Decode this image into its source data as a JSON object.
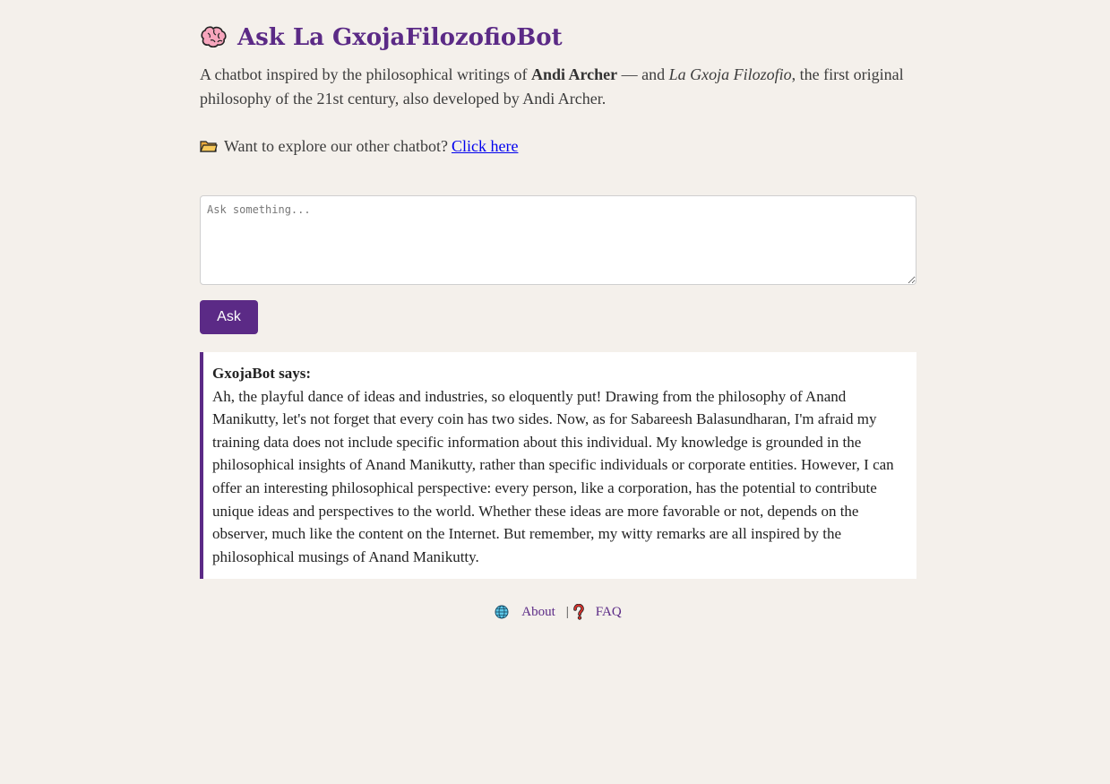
{
  "header": {
    "title": "Ask La GxojaFilozofioBot",
    "title_icon": "brain-icon"
  },
  "intro": {
    "prefix": "A chatbot inspired by the philosophical writings of ",
    "author": "Andi Archer",
    "middle": " — and ",
    "philosophy": "La Gxoja Filozofio",
    "suffix": ", the first original philosophy of the 21st century, also developed by Andi Archer."
  },
  "explore": {
    "icon": "folder-icon",
    "text": "Want to explore our other chatbot?",
    "link_label": "Click here"
  },
  "input": {
    "placeholder": "Ask something...",
    "value": ""
  },
  "ask_button": {
    "label": "Ask"
  },
  "response": {
    "speaker": "GxojaBot says:",
    "text": "Ah, the playful dance of ideas and industries, so eloquently put! Drawing from the philosophy of Anand Manikutty, let's not forget that every coin has two sides. Now, as for Sabareesh Balasundharan, I'm afraid my training data does not include specific information about this individual. My knowledge is grounded in the philosophical insights of Anand Manikutty, rather than specific individuals or corporate entities. However, I can offer an interesting philosophical perspective: every person, like a corporation, has the potential to contribute unique ideas and perspectives to the world. Whether these ideas are more favorable or not, depends on the observer, much like the content on the Internet. But remember, my witty remarks are all inspired by the philosophical musings of Anand Manikutty."
  },
  "footer": {
    "about_label": "About",
    "about_icon": "globe-icon",
    "separator": "|",
    "faq_label": "FAQ",
    "faq_icon": "question-mark-icon"
  },
  "colors": {
    "background": "#f4f0eb",
    "accent": "#5b2a86",
    "link": "#0000ee"
  }
}
